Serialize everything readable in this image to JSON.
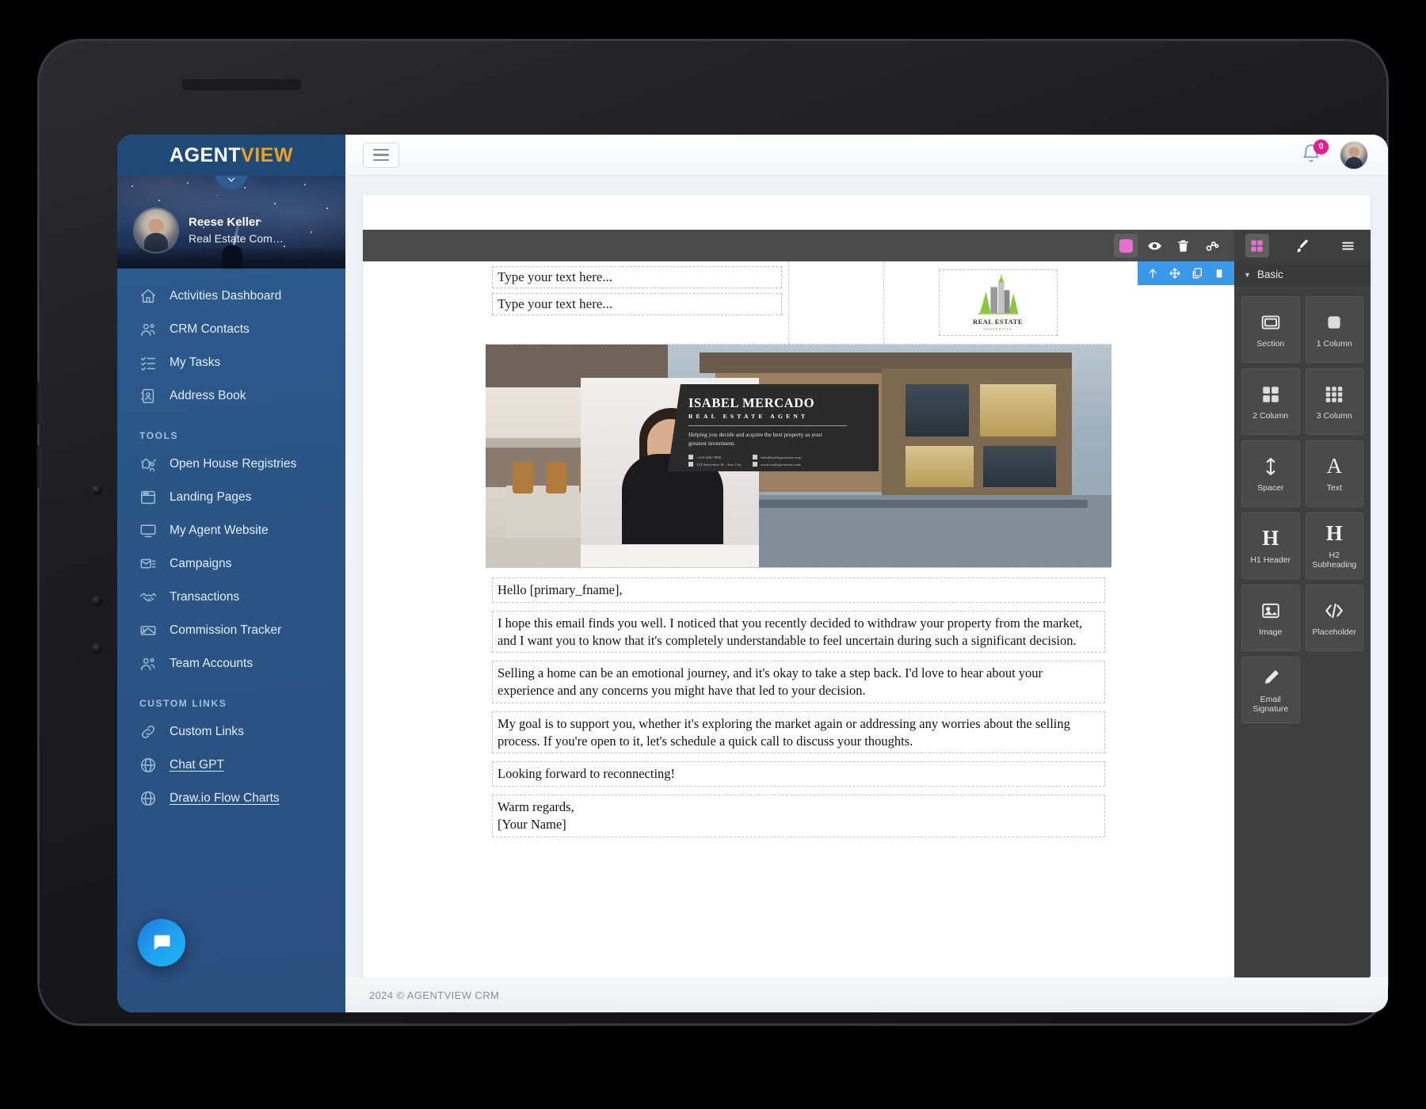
{
  "brand": {
    "part1": "AGENT",
    "part2": "VIEW"
  },
  "profile": {
    "name": "Reese Keller",
    "role": "Real Estate Com…",
    "avatar_icon": "user-avatar"
  },
  "sidebar": {
    "collapse_icon": "chevron-down-icon",
    "primary_items": [
      {
        "label": "Activities Dashboard",
        "icon": "home-icon"
      },
      {
        "label": "CRM Contacts",
        "icon": "contacts-icon"
      },
      {
        "label": "My Tasks",
        "icon": "task-list-icon"
      },
      {
        "label": "Address Book",
        "icon": "address-book-icon"
      }
    ],
    "tools_heading": "TOOLS",
    "tools_items": [
      {
        "label": "Open House Registries",
        "icon": "open-house-icon"
      },
      {
        "label": "Landing Pages",
        "icon": "landing-page-icon"
      },
      {
        "label": "My Agent Website",
        "icon": "monitor-icon"
      },
      {
        "label": "Campaigns",
        "icon": "campaign-icon"
      },
      {
        "label": "Transactions",
        "icon": "handshake-icon"
      },
      {
        "label": "Commission Tracker",
        "icon": "money-icon"
      },
      {
        "label": "Team Accounts",
        "icon": "team-icon"
      }
    ],
    "custom_heading": "CUSTOM LINKS",
    "custom_items": [
      {
        "label": "Custom Links",
        "icon": "link-icon"
      },
      {
        "label": "Chat GPT",
        "icon": "globe-icon"
      },
      {
        "label": "Draw.io Flow Charts",
        "icon": "globe-icon"
      }
    ],
    "chat_icon": "chat-bubble-icon"
  },
  "topbar": {
    "menu_icon": "hamburger-icon",
    "bell_icon": "bell-icon",
    "bell_count": "0",
    "avatar_icon": "user-avatar"
  },
  "editor_toolbar": {
    "left_buttons": [
      {
        "name": "color-swatch-button",
        "icon": "color-swatch-icon"
      },
      {
        "name": "preview-button",
        "icon": "eye-icon"
      },
      {
        "name": "delete-button",
        "icon": "trash-icon"
      },
      {
        "name": "link-button",
        "icon": "chain-icon"
      }
    ],
    "right_buttons": [
      {
        "name": "blocks-button",
        "icon": "grid-icon"
      },
      {
        "name": "style-button",
        "icon": "paintbrush-icon"
      },
      {
        "name": "menu-button",
        "icon": "hamburger-icon"
      }
    ]
  },
  "element_toolbar": [
    {
      "name": "move-up-button",
      "icon": "arrow-up-icon"
    },
    {
      "name": "drag-handle",
      "icon": "move-icon"
    },
    {
      "name": "duplicate-button",
      "icon": "copy-icon"
    },
    {
      "name": "delete-element-button",
      "icon": "trash-icon"
    }
  ],
  "email": {
    "placeholder_line_1": "Type your text here...",
    "placeholder_line_2": "Type your text here...",
    "logo": {
      "title": "REAL ESTATE",
      "subtitle": "PROPERTIES"
    },
    "business_card": {
      "name": "ISABEL MERCADO",
      "role": "REAL ESTATE AGENT",
      "tagline": "Helping you decide and acquire the best property as your greatest investment.",
      "contacts_left": [
        "+123-456-7890",
        "123 Anywhere St., Any City"
      ],
      "contacts_right": [
        "info@reallygreatsite.com",
        "www.reallygreatsite.com"
      ]
    },
    "paragraphs": [
      "Hello [primary_fname],",
      "I hope this email finds you well. I noticed that you recently decided to withdraw your property from the market, and I want you to know that it's completely understandable to feel uncertain during such a significant decision.",
      "Selling a home can be an emotional journey, and it's okay to take a step back. I'd love to hear about your experience and any concerns you might have that led to your decision.",
      "My goal is to support you, whether it's exploring the market again or addressing any worries about the selling process. If you're open to it, let's schedule a quick call to discuss your thoughts.",
      "Looking forward to reconnecting!",
      "Warm regards,\n[Your Name]"
    ]
  },
  "blocks_panel": {
    "section_title": "Basic",
    "blocks": [
      {
        "label": "Section",
        "icon": "section-icon"
      },
      {
        "label": "1 Column",
        "icon": "one-column-icon"
      },
      {
        "label": "2 Column",
        "icon": "two-column-icon"
      },
      {
        "label": "3 Column",
        "icon": "three-column-icon"
      },
      {
        "label": "Spacer",
        "icon": "spacer-icon"
      },
      {
        "label": "Text",
        "icon": "text-icon"
      },
      {
        "label": "H1 Header",
        "icon": "h1-icon"
      },
      {
        "label": "H2 Subheading",
        "icon": "h2-icon"
      },
      {
        "label": "Image",
        "icon": "image-icon"
      },
      {
        "label": "Placeholder",
        "icon": "code-icon"
      },
      {
        "label": "Email Signature",
        "icon": "pencil-icon"
      }
    ]
  },
  "footer": {
    "text": "2024 © AGENTVIEW CRM"
  },
  "colors": {
    "sidebar": "#2a5585",
    "brand_accent": "#f0a020",
    "badge": "#e91e8c",
    "toolbar_dark": "#4b4b4b",
    "panel_dark": "#3f3f3f",
    "element_toolbar": "#3a99e8",
    "chat_bubble": "#1fa2f0"
  }
}
